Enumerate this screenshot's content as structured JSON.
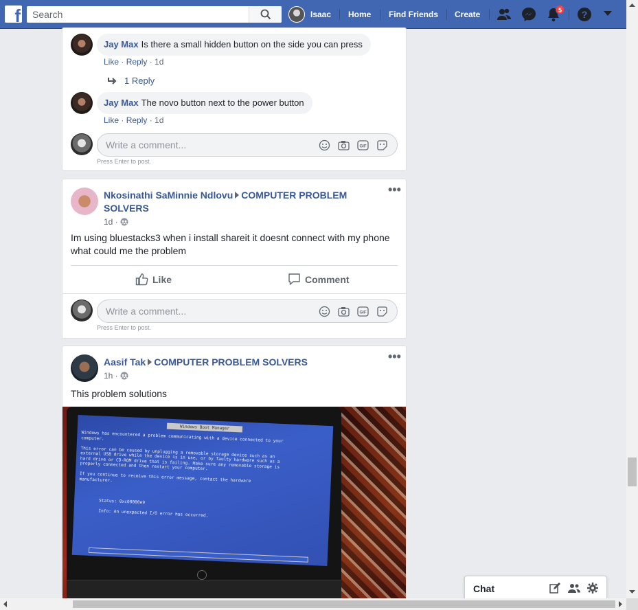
{
  "topbar": {
    "logo_letter": "f",
    "search_placeholder": "Search",
    "user_name": "Isaac",
    "nav": [
      "Home",
      "Find Friends",
      "Create"
    ],
    "notification_count": "5",
    "icons": [
      "friends-icon",
      "messenger-icon",
      "notifications-icon",
      "help-icon",
      "account-menu-icon"
    ],
    "brand_color": "#4267b2"
  },
  "comments": [
    {
      "author": "Jay Max",
      "text": "Is there a small hidden button on the side you can press",
      "like": "Like",
      "reply": "Reply",
      "time": "1d"
    },
    {
      "author": "Jay Max",
      "text": "The novo button next to the power button",
      "like": "Like",
      "reply": "Reply",
      "time": "1d"
    }
  ],
  "replies_link": "1 Reply",
  "composer": {
    "placeholder": "Write a comment...",
    "hint": "Press Enter to post.",
    "icons": [
      "emoji-icon",
      "camera-icon",
      "gif-icon",
      "sticker-icon"
    ]
  },
  "posts": [
    {
      "author": "Nkosinathi SaMinnie Ndlovu",
      "group_line1": "COMPUTER PROBLEM",
      "group_line2": "SOLVERS",
      "time": "1d",
      "text_line1": "Im using bluestacks3 when i install shareit it doesnt connect with my phone",
      "text_line2": "what could me the problem",
      "like": "Like",
      "comment": "Comment"
    },
    {
      "author": "Aasif Tak",
      "group": "COMPUTER PROBLEM SOLVERS",
      "time": "1h",
      "text": "This problem solutions",
      "photo": {
        "title": "Windows Boot Manager",
        "body": "Windows has encountered a problem communicating with a device connected to your\ncomputer.\n\nThis error can be caused by unplugging a removable storage device such as an\nexternal USB drive while the device is in use, or by faulty hardware such as a\nhard drive or CD-ROM drive that is failing. Make sure any removable storage is\nproperly connected and then restart your computer.\n\nIf you continue to receive this error message, contact the hardware\nmanufacturer.\n\n\n\n        Status: 0xc00000e9\n\n        Info: An unexpected I/O error has occurred."
      }
    }
  ],
  "chat": {
    "label": "Chat",
    "icons": [
      "compose-icon",
      "group-chat-icon",
      "settings-icon"
    ]
  }
}
